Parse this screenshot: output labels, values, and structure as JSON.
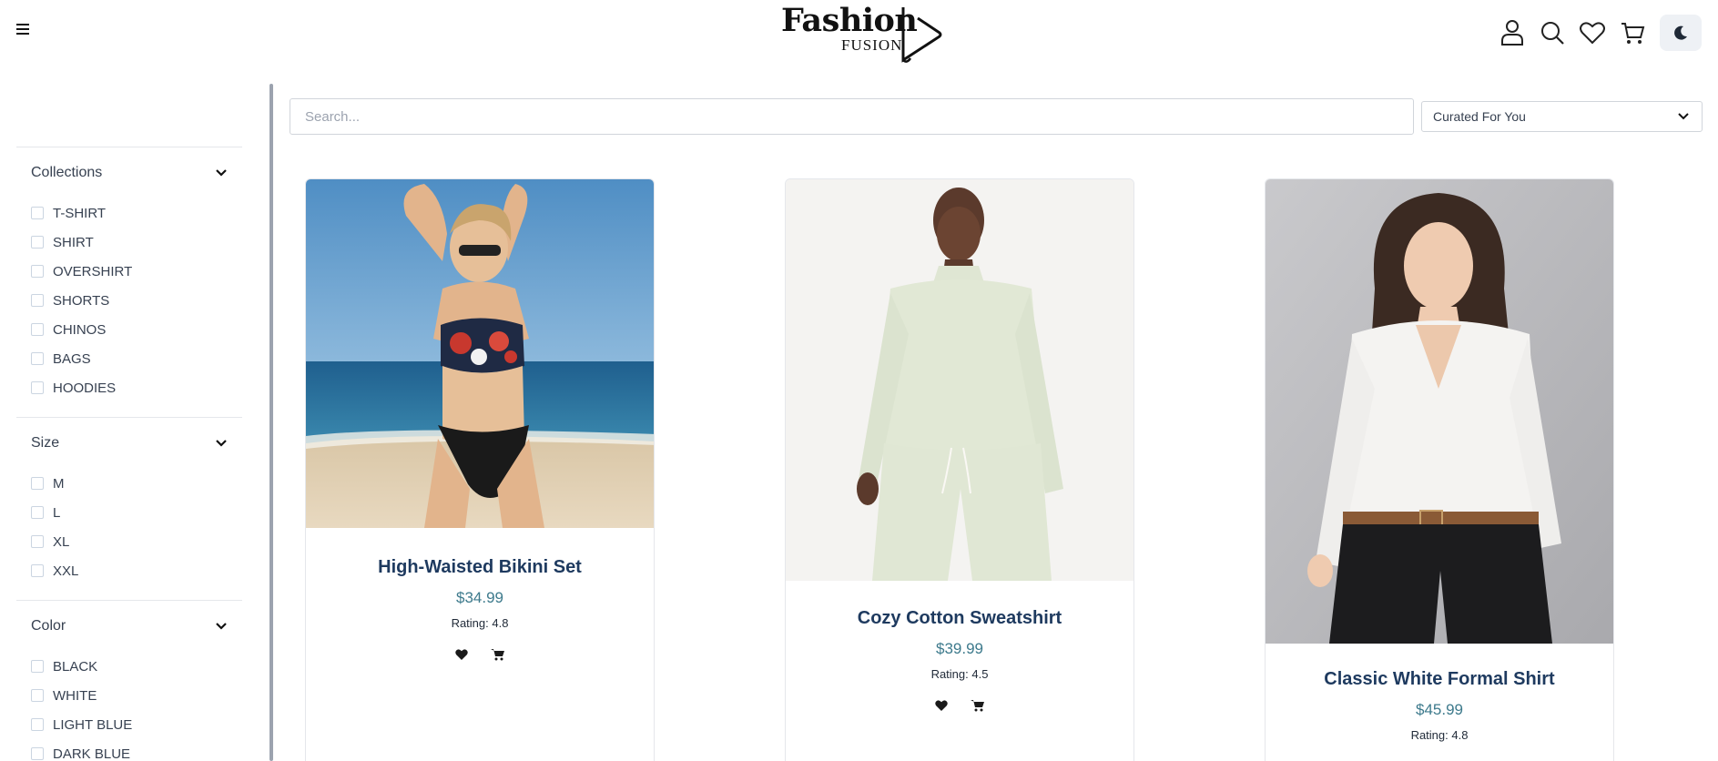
{
  "header": {
    "logo_main": "Fashion",
    "logo_sub": "FUSION",
    "icons": [
      "user-icon",
      "search-icon",
      "heart-icon",
      "cart-icon",
      "moon-icon"
    ]
  },
  "filters": {
    "collections": {
      "title": "Collections",
      "items": [
        "T-SHIRT",
        "SHIRT",
        "OVERSHIRT",
        "SHORTS",
        "CHINOS",
        "BAGS",
        "HOODIES"
      ]
    },
    "size": {
      "title": "Size",
      "items": [
        "M",
        "L",
        "XL",
        "XXL"
      ]
    },
    "color": {
      "title": "Color",
      "items": [
        "BLACK",
        "WHITE",
        "LIGHT BLUE",
        "DARK BLUE"
      ]
    }
  },
  "search": {
    "placeholder": "Search...",
    "value": ""
  },
  "sort": {
    "selected": "Curated For You"
  },
  "products": [
    {
      "name": "High-Waisted Bikini Set",
      "price": "$34.99",
      "rating": "Rating: 4.8"
    },
    {
      "name": "Cozy Cotton Sweatshirt",
      "price": "$39.99",
      "rating": "Rating: 4.5"
    },
    {
      "name": "Classic White Formal Shirt",
      "price": "$45.99",
      "rating": "Rating: 4.8"
    }
  ],
  "colors": {
    "accent_price": "#3d7a8c",
    "title": "#1e3a5f",
    "theme_button_bg": "#eef1f5"
  }
}
